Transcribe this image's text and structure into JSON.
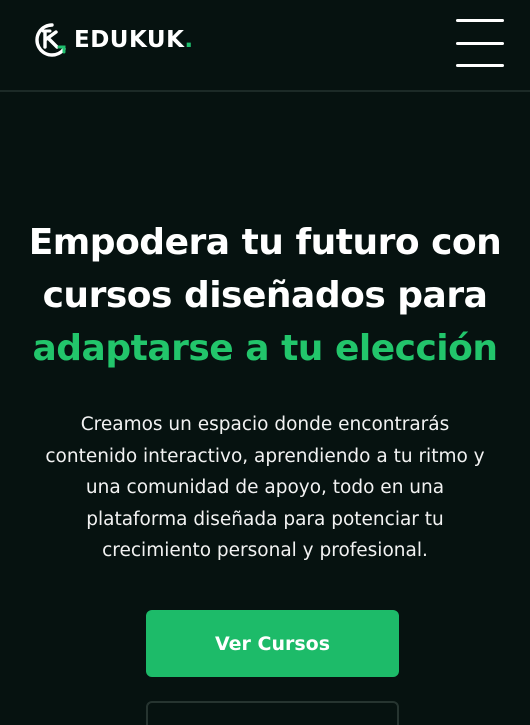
{
  "header": {
    "logo_text_white": "EDU",
    "logo_text_accent": "KUK",
    "logo_dot": ".",
    "menu_icon": "hamburger-menu-icon"
  },
  "hero": {
    "title_line1": "Empodera tu futuro con",
    "title_line2": "cursos diseñados para",
    "title_highlight": "adaptarse a tu elección",
    "description": "Creamos un espacio donde encontrarás contenido interactivo, aprendiendo a tu ritmo y una comunidad de apoyo, todo en una plataforma diseñada para potenciar tu crecimiento personal y profesional.",
    "primary_button": "Ver Cursos"
  },
  "colors": {
    "background": "#061210",
    "accent": "#1dbb69",
    "text": "#ffffff"
  }
}
